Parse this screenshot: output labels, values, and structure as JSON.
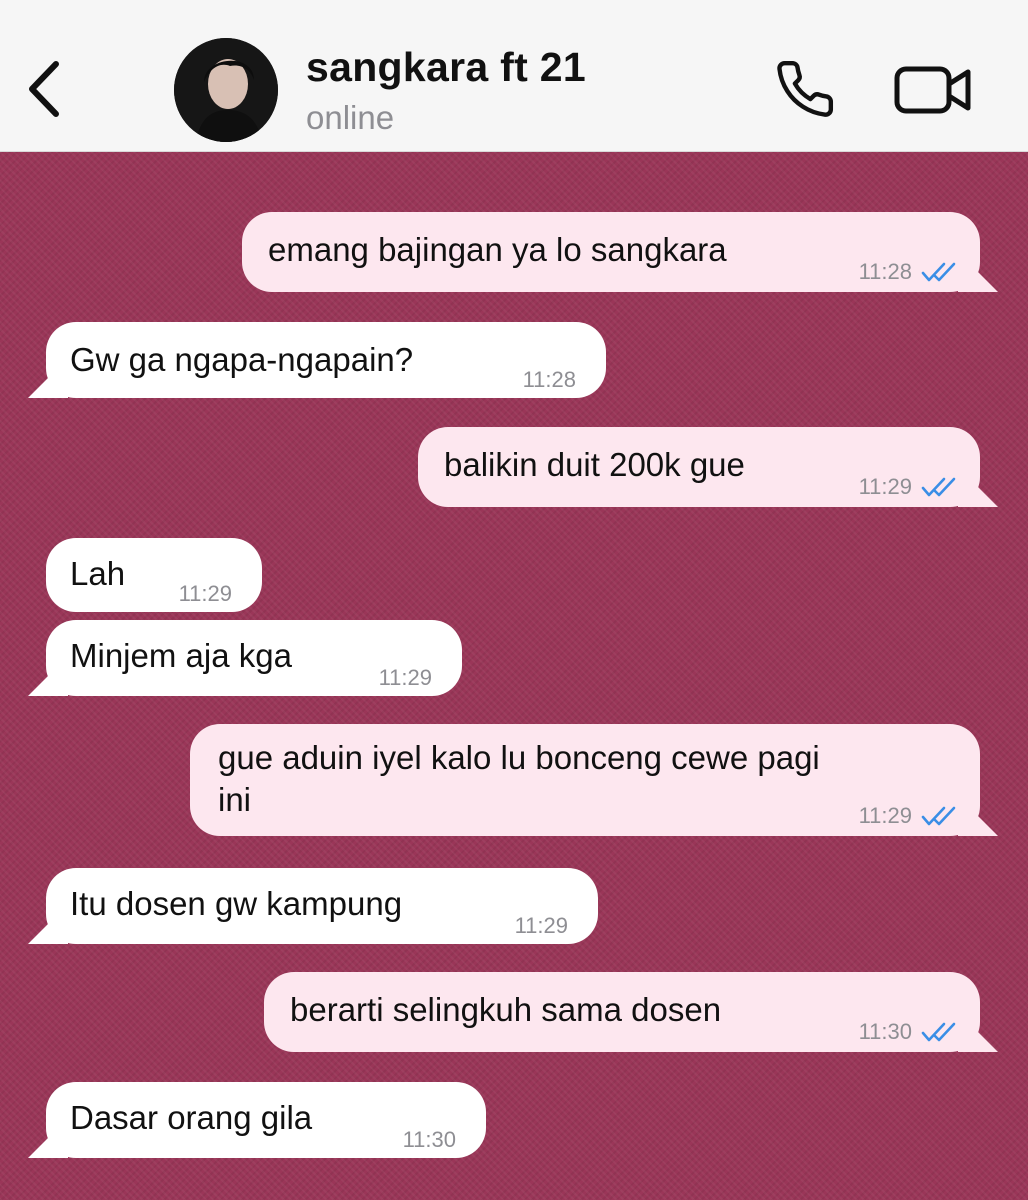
{
  "header": {
    "contact_name": "sangkara ft 21",
    "status": "online"
  },
  "messages": [
    {
      "direction": "out",
      "text": "emang bajingan ya lo sangkara",
      "time": "11:28",
      "receipt": "read"
    },
    {
      "direction": "in",
      "text": "Gw ga ngapa-ngapain?",
      "time": "11:28"
    },
    {
      "direction": "out",
      "text": "balikin duit 200k gue",
      "time": "11:29",
      "receipt": "read"
    },
    {
      "direction": "in",
      "text": "Lah",
      "time": "11:29"
    },
    {
      "direction": "in",
      "text": "Minjem aja kga",
      "time": "11:29"
    },
    {
      "direction": "out",
      "text_line1": "gue aduin iyel kalo lu bonceng cewe pagi",
      "text_line2": "ini",
      "time": "11:29",
      "receipt": "read"
    },
    {
      "direction": "in",
      "text": "Itu dosen gw kampung",
      "time": "11:29"
    },
    {
      "direction": "out",
      "text": "berarti selingkuh sama dosen",
      "time": "11:30",
      "receipt": "read"
    },
    {
      "direction": "in",
      "text": "Dasar orang gila",
      "time": "11:30"
    }
  ],
  "icons": {
    "back": "chevron-left-icon",
    "call": "phone-icon",
    "video": "video-camera-icon",
    "receipt": "double-check-icon"
  },
  "colors": {
    "header_bg": "#f6f6f6",
    "chat_bg": "#9a3658",
    "outgoing_bubble": "#fde7ef",
    "incoming_bubble": "#ffffff",
    "read_receipt": "#3a8ee6"
  }
}
